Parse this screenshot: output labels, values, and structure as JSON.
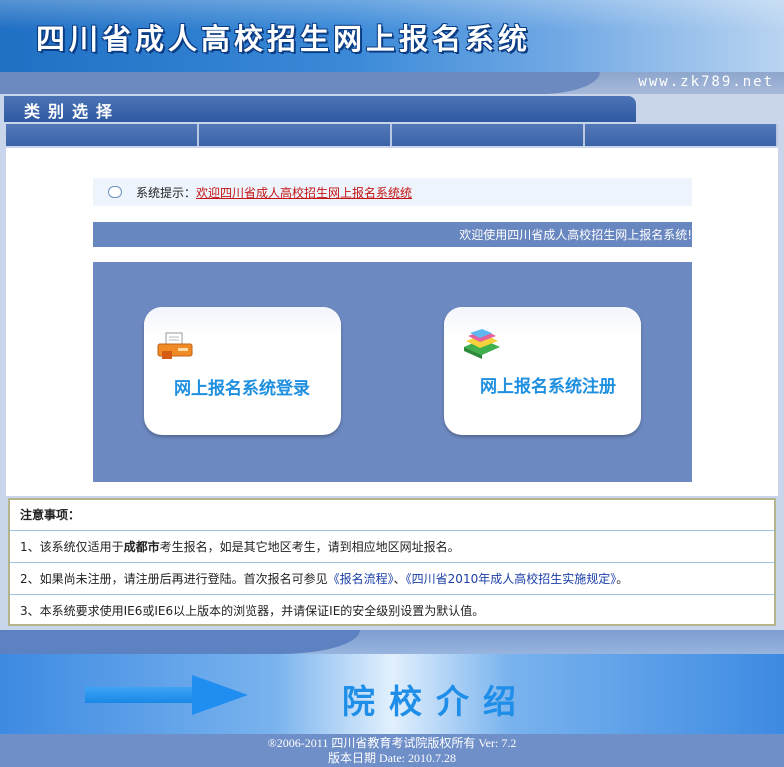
{
  "header": {
    "title": "四川省成人高校招生网上报名系统",
    "url": "www.zk789.net"
  },
  "category": {
    "label": "类别选择"
  },
  "notice": {
    "label": "系统提示：",
    "text": "欢迎四川省成人高校招生网上报名系统统"
  },
  "welcome": {
    "text": "欢迎使用四川省成人高校招生网上报名系统!"
  },
  "actions": {
    "login_label": "网上报名系统登录",
    "register_label": "网上报名系统注册"
  },
  "notes": {
    "title": "注意事项：",
    "items": [
      {
        "prefix": "1、该系统仅适用于",
        "bold": "成都市",
        "suffix": "考生报名，如是其它地区考生，请到相应地区网址报名。"
      },
      {
        "prefix": "2、如果尚未注册，请注册后再进行登陆。首次报名可参见",
        "link1": "《报名流程》",
        "mid": "、",
        "link2": "《四川省2010年成人高校招生实施规定》",
        "suffix": "。"
      },
      {
        "text": "3、本系统要求使用IE6或IE6以上版本的浏览器，并请保证IE的安全级别设置为默认值。"
      }
    ]
  },
  "footer": {
    "intro": "院校介绍",
    "copyright": "®2006-2011 四川省教育考试院版权所有  Ver: 7.2",
    "date": "版本日期  Date: 2010.7.28"
  },
  "colors": {
    "header_blue": "#1f6fc4",
    "panel_blue": "#6d89c1",
    "label_blue": "#1f8fe0",
    "notice_red": "#c21414"
  }
}
